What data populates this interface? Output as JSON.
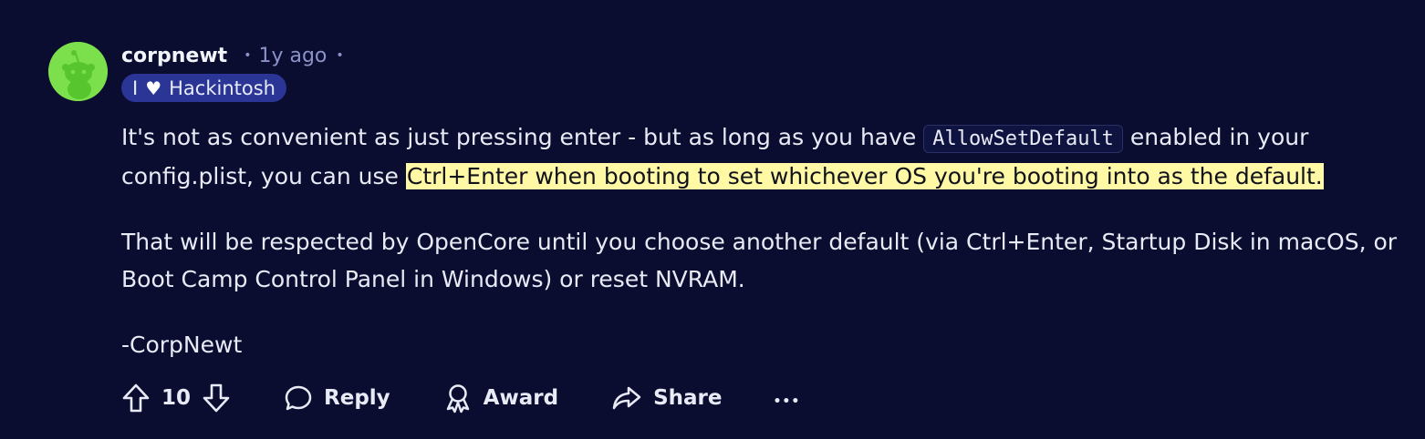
{
  "comment": {
    "username": "corpnewt",
    "separator": "•",
    "time_ago": "1y ago",
    "flair": {
      "prefix": "I",
      "heart": "♥",
      "text": "Hackintosh"
    },
    "body": {
      "p1_before_code": "It's not as convenient as just pressing enter - but as long as you have ",
      "code": "AllowSetDefault",
      "p1_after_code": " enabled in your config.plist, you can use ",
      "p1_highlight": "Ctrl+Enter when booting to set whichever OS you're booting into as the default.",
      "p2": "That will be respected by OpenCore until you choose another default (via Ctrl+Enter, Startup Disk in macOS, or Boot Camp Control Panel in Windows) or reset NVRAM.",
      "p3": "-CorpNewt"
    },
    "actions": {
      "vote_count": "10",
      "reply_label": "Reply",
      "award_label": "Award",
      "share_label": "Share",
      "more_label": "•••"
    }
  },
  "colors": {
    "background": "#0b0d30",
    "flair_bg": "#2a3596",
    "highlight": "#fff8a5",
    "avatar": "#7be04b"
  },
  "icons": {
    "upvote": "upvote-icon",
    "downvote": "downvote-icon",
    "reply": "speech-bubble-icon",
    "award": "award-icon",
    "share": "share-arrow-icon",
    "more": "more-dots-icon",
    "avatar": "snoo-avatar-icon"
  }
}
